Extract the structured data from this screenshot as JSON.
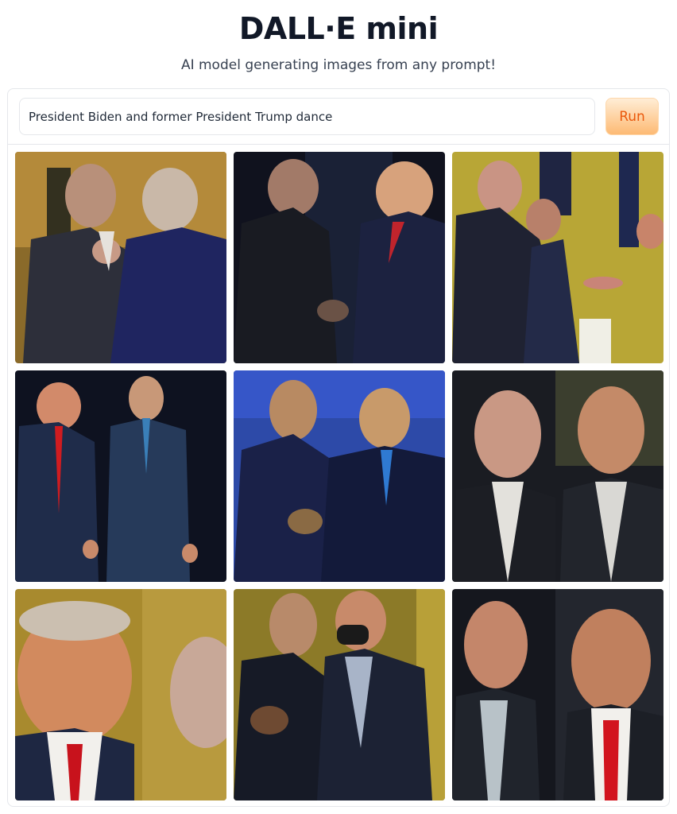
{
  "header": {
    "title": "DALL·E mini",
    "subtitle": "AI model generating images from any prompt!"
  },
  "prompt": {
    "value": "President Biden and former President Trump dance"
  },
  "run_button": {
    "label": "Run"
  },
  "results": {
    "count": 9
  }
}
